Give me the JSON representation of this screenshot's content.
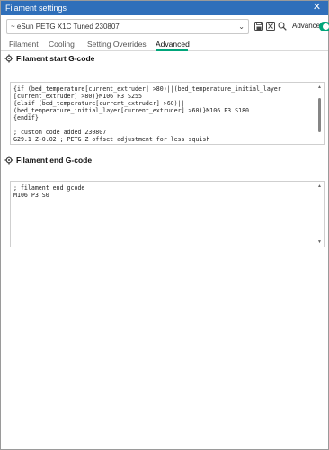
{
  "window": {
    "title": "Filament settings",
    "close_glyph": "✕"
  },
  "preset": {
    "name": "~ eSun PETG X1C Tuned 230807",
    "dropdown_glyph": "⌄"
  },
  "toolbar": {
    "save_icon": "save-icon",
    "delete_icon": "delete-icon",
    "search_icon": "search-icon",
    "advanced_label": "Advanced",
    "advanced_enabled": true,
    "accent_color": "#00a57a"
  },
  "tabs": [
    {
      "label": "Filament",
      "active": false
    },
    {
      "label": "Cooling",
      "active": false
    },
    {
      "label": "Setting Overrides",
      "active": false
    },
    {
      "label": "Advanced",
      "active": true
    }
  ],
  "sections": {
    "start": {
      "title": "Filament start G-code",
      "code": "{if (bed_temperature[current_extruder] >80)||(bed_temperature_initial_layer\n[current_extruder] >80)}M106 P3 S255\n{elsif (bed_temperature[current_extruder] >60)||\n(bed_temperature_initial_layer[current_extruder] >60)}M106 P3 S180\n{endif}\n\n; custom code added 230807\nG29.1 Z+0.02 ; PETG Z offset adjustment for less squish"
    },
    "end": {
      "title": "Filament end G-code",
      "code": "; filament end gcode\nM106 P3 S0"
    }
  }
}
